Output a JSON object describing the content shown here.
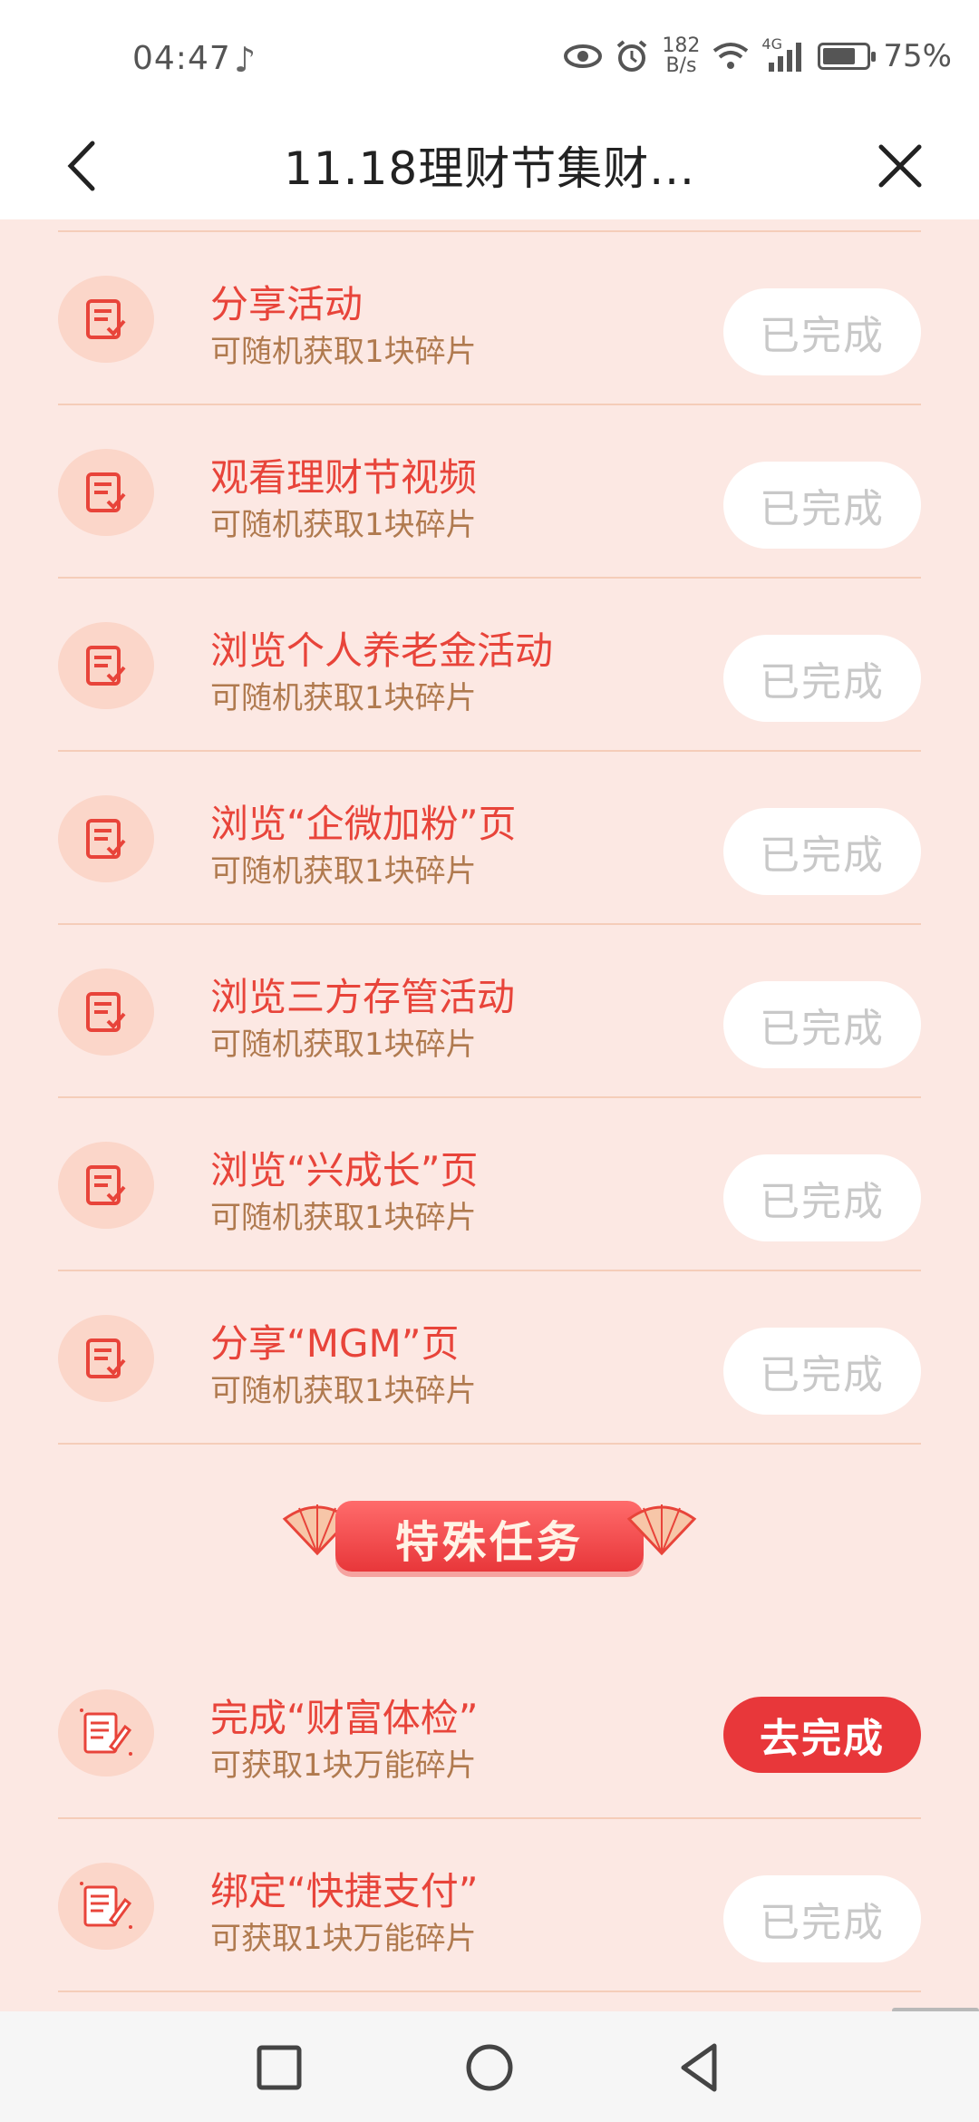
{
  "status_bar": {
    "time": "04:47",
    "speed_top": "182",
    "speed_bottom": "B/s",
    "network": "4G",
    "battery_pct": "75%",
    "icons": [
      "music-note-icon",
      "eye-icon",
      "alarm-icon",
      "wifi-icon",
      "signal-icon",
      "battery-icon"
    ]
  },
  "header": {
    "title": "11.18理财节集财...",
    "back_icon": "chevron-left-icon",
    "close_icon": "close-icon"
  },
  "tasks": [
    {
      "title": "分享活动",
      "subtitle": "可随机获取1块碎片",
      "button": "已完成",
      "state": "done"
    },
    {
      "title": "观看理财节视频",
      "subtitle": "可随机获取1块碎片",
      "button": "已完成",
      "state": "done"
    },
    {
      "title": "浏览个人养老金活动",
      "subtitle": "可随机获取1块碎片",
      "button": "已完成",
      "state": "done"
    },
    {
      "title": "浏览“企微加粉”页",
      "subtitle": "可随机获取1块碎片",
      "button": "已完成",
      "state": "done"
    },
    {
      "title": "浏览三方存管活动",
      "subtitle": "可随机获取1块碎片",
      "button": "已完成",
      "state": "done"
    },
    {
      "title": "浏览“兴成长”页",
      "subtitle": "可随机获取1块碎片",
      "button": "已完成",
      "state": "done"
    },
    {
      "title": "分享“MGM”页",
      "subtitle": "可随机获取1块碎片",
      "button": "已完成",
      "state": "done"
    }
  ],
  "special_section": {
    "title": "特殊任务",
    "tasks": [
      {
        "title": "完成“财富体检”",
        "subtitle": "可获取1块万能碎片",
        "button": "去完成",
        "state": "todo"
      },
      {
        "title": "绑定“快捷支付”",
        "subtitle": "可获取1块万能碎片",
        "button": "已完成",
        "state": "done"
      }
    ]
  },
  "colors": {
    "background": "#fce8e3",
    "title_red": "#e8443a",
    "subtitle_brown": "#b07a4f",
    "active_button": "#e8373a"
  },
  "navbar": {
    "icons": [
      "recent-apps-icon",
      "home-icon",
      "back-triangle-icon"
    ]
  }
}
